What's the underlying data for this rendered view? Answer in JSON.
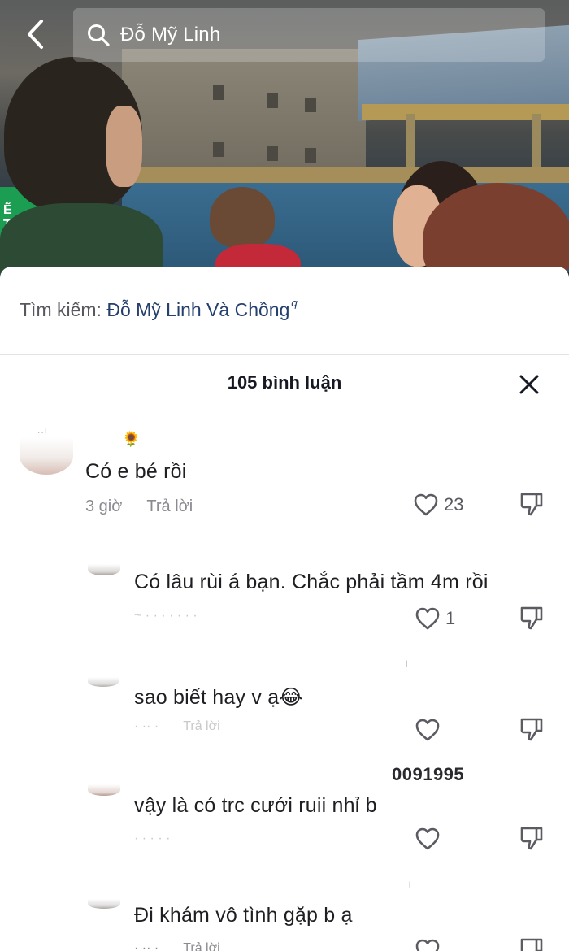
{
  "search": {
    "query": "Đỗ Mỹ Linh"
  },
  "sheet": {
    "related_label": "Tìm kiếm:",
    "related_term": "Đỗ Mỹ Linh Và Chồng",
    "comment_count": "105 bình luận"
  },
  "comments": [
    {
      "text": "Có e bé rồi",
      "time": "3 giờ",
      "reply": "Trả lời",
      "likes": "23",
      "badge": "🌻"
    },
    {
      "text": "Có lâu rùi á bạn. Chắc phải tầm 4m rồi",
      "likes": "1"
    },
    {
      "text": "sao biết hay v ạ😂",
      "reply": "Trả lời"
    },
    {
      "text": "vậy là có trc cưới ruii nhỉ b",
      "overlay": "0091995"
    },
    {
      "text": "Đi khám vô tình gặp b ạ",
      "reply": "Trả lời"
    }
  ],
  "colors": {
    "accent_link": "#25406e",
    "text_primary": "#161823",
    "text_meta": "#8a8b91"
  }
}
